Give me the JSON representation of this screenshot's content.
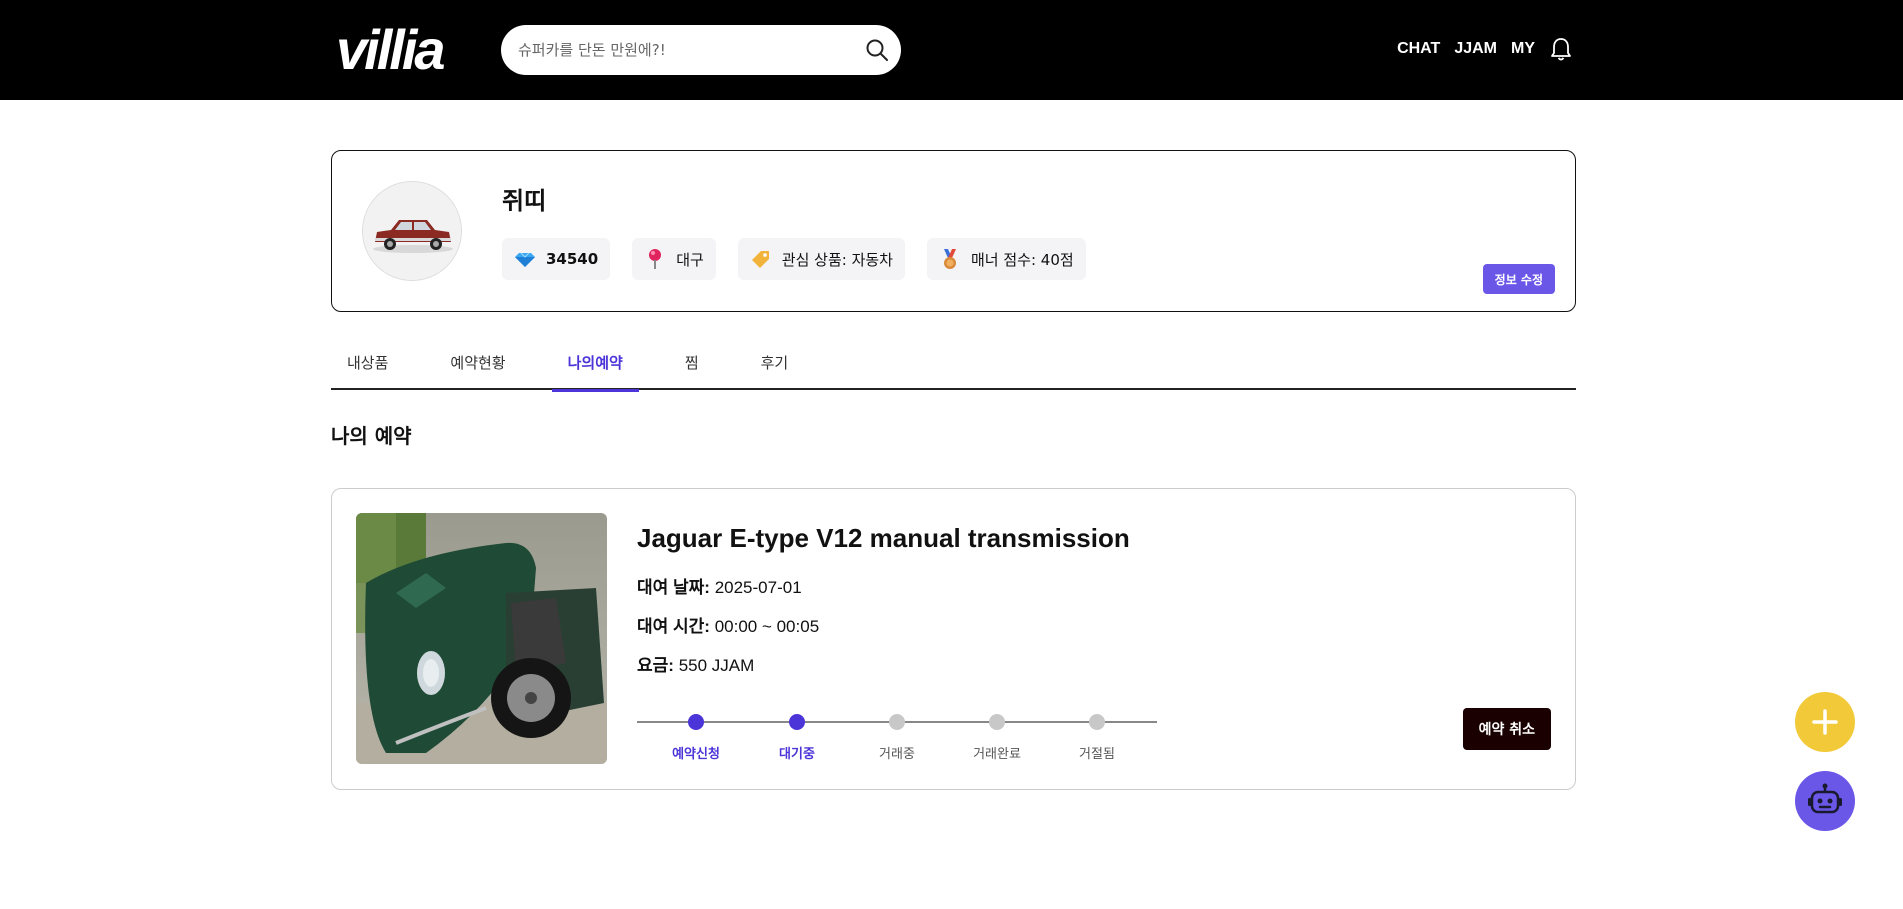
{
  "header": {
    "logo": "villia",
    "search_placeholder": "슈퍼카를 단돈 만원에?!",
    "nav": [
      "CHAT",
      "JJAM",
      "MY"
    ]
  },
  "profile": {
    "name": "쥐띠",
    "points": "34540",
    "location": "대구",
    "interest": "관심 상품: 자동차",
    "manner": "매너 점수: 40점",
    "edit_label": "정보 수정"
  },
  "tabs": [
    {
      "label": "내상품",
      "active": false
    },
    {
      "label": "예약현황",
      "active": false
    },
    {
      "label": "나의예약",
      "active": true
    },
    {
      "label": "찜",
      "active": false
    },
    {
      "label": "후기",
      "active": false
    }
  ],
  "section_title": "나의 예약",
  "reservation": {
    "title": "Jaguar E-type V12 manual transmission",
    "date_label": "대여 날짜:",
    "date_value": "2025-07-01",
    "time_label": "대여 시간:",
    "time_value": "00:00 ~ 00:05",
    "fee_label": "요금:",
    "fee_value": "550 JJAM",
    "steps": [
      {
        "label": "예약신청",
        "done": true
      },
      {
        "label": "대기중",
        "done": true
      },
      {
        "label": "거래중",
        "done": false
      },
      {
        "label": "거래완료",
        "done": false
      },
      {
        "label": "거절됨",
        "done": false
      }
    ],
    "cancel_label": "예약 취소"
  },
  "colors": {
    "accent": "#4b35d8",
    "edit_button": "#6a57e8",
    "fab_add": "#f2c938",
    "fab_bot": "#6a57e8"
  },
  "icons": [
    "search-icon",
    "bell-icon",
    "gem-icon",
    "pin-icon",
    "tag-icon",
    "medal-icon",
    "plus-icon",
    "robot-icon"
  ]
}
